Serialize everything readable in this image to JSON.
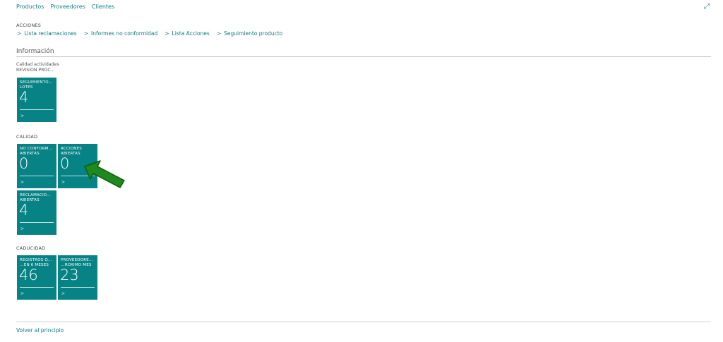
{
  "topnav": {
    "items": [
      "Productos",
      "Proveedores",
      "Clientes"
    ]
  },
  "expand_icon": "expand-icon",
  "acciones": {
    "title": "ACCIONES",
    "links": [
      "Lista reclamaciones",
      "Informes no conformidad",
      "Lista Acciones",
      "Seguimiento producto"
    ]
  },
  "informacion": {
    "title": "Información"
  },
  "calidad_actividades": {
    "title": "Calidad actividades",
    "subtitle": "REVISION PROC...",
    "tiles": [
      {
        "label": "SEGUIMIENTO... LOTES",
        "value": "4"
      }
    ]
  },
  "calidad": {
    "title": "CALIDAD",
    "tiles": [
      {
        "label": "NO CONFORM... ABIERTAS",
        "value": "0"
      },
      {
        "label": "ACCIONES ABIERTAS",
        "value": "0"
      },
      {
        "label": "RECLAMACIO... ABIERTAS",
        "value": "4"
      }
    ]
  },
  "caducidad": {
    "title": "CADUCIDAD",
    "tiles": [
      {
        "label": "REGISTROS Q... ...EN 6 MESES",
        "value": "46"
      },
      {
        "label": "PROVEEDORE... ...ROXIMO MES",
        "value": "23"
      }
    ]
  },
  "tile_chevron": ">",
  "link_chevron": ">",
  "footer": {
    "back_label": "Volver al principio"
  },
  "colors": {
    "tile": "#078386",
    "link": "#0e7c86",
    "arrow": "#1e8a1e"
  }
}
